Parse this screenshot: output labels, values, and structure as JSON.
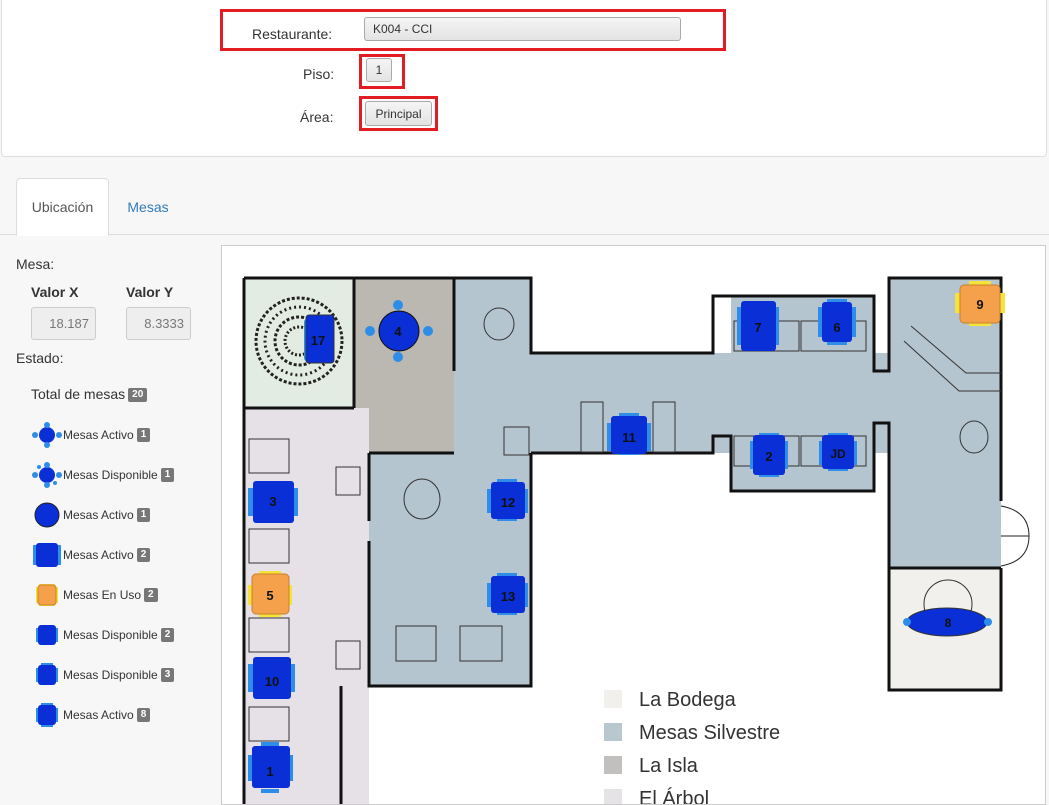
{
  "filters": {
    "restaurant_label": "Restaurante:",
    "restaurant_value": "K004 - CCI",
    "floor_label": "Piso:",
    "floor_value": "1",
    "area_label": "Área:",
    "area_value": "Principal",
    "highlight_color": "#e31b23"
  },
  "tabs": [
    {
      "label": "Ubicación",
      "active": true
    },
    {
      "label": "Mesas",
      "active": false
    }
  ],
  "sidebar": {
    "mesa_label": "Mesa:",
    "valor_x_label": "Valor X",
    "valor_y_label": "Valor Y",
    "valor_x": "18.187",
    "valor_y": "8.3333",
    "estado_label": "Estado:",
    "total_label": "Total de mesas",
    "total_count": "20",
    "legend": [
      {
        "icon": "round-small-active-icon",
        "label": "Mesas Activo",
        "count": "1"
      },
      {
        "icon": "round-small-available-icon",
        "label": "Mesas Disponible",
        "count": "1"
      },
      {
        "icon": "round-large-active-icon",
        "label": "Mesas Activo",
        "count": "1"
      },
      {
        "icon": "square-large-active-icon",
        "label": "Mesas Activo",
        "count": "2"
      },
      {
        "icon": "square-in-use-icon",
        "label": "Mesas En Uso",
        "count": "2"
      },
      {
        "icon": "square-available-icon",
        "label": "Mesas Disponible",
        "count": "2"
      },
      {
        "icon": "square-available-icon",
        "label": "Mesas Disponible",
        "count": "3"
      },
      {
        "icon": "square-active-icon",
        "label": "Mesas Activo",
        "count": "8"
      }
    ]
  },
  "floorplan": {
    "tables": [
      "17",
      "4",
      "7",
      "6",
      "9",
      "11",
      "2",
      "JD",
      "3",
      "12",
      "5",
      "13",
      "8",
      "10",
      "1"
    ],
    "zones": [
      {
        "label": "La Bodega",
        "color": "#f1f0ec"
      },
      {
        "label": "Mesas Silvestre",
        "color": "#b9c7cf"
      },
      {
        "label": "La Isla",
        "color": "#c2c0be"
      },
      {
        "label": "El Árbol",
        "color": "#e5e3e5"
      }
    ],
    "colors": {
      "active_blue": "#0a2fd6",
      "in_use_orange": "#f5a04a",
      "wall": "#111111"
    }
  }
}
